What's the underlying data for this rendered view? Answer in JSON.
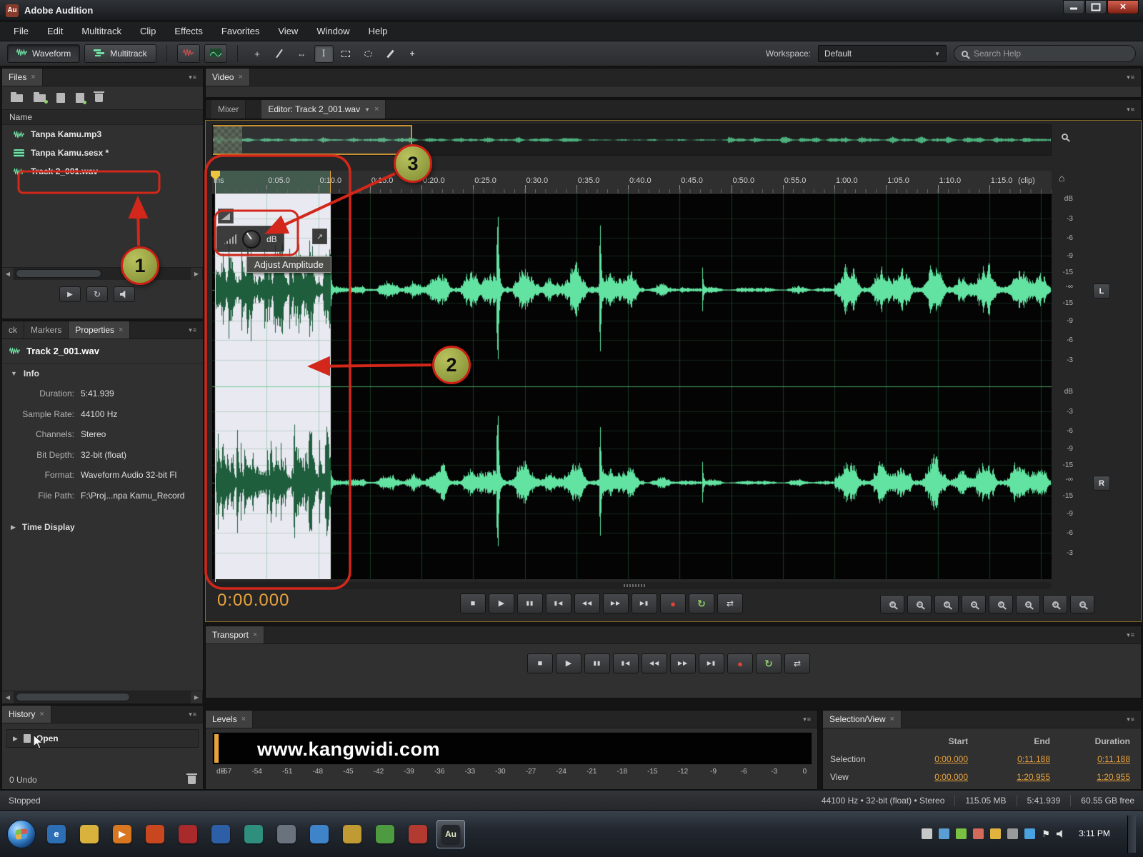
{
  "glyphs": {
    "close": "×",
    "dropdown": "▼",
    "section_open": "▼",
    "section_closed": "▶",
    "home": "⌂",
    "panel_menu": "▾≡",
    "left": "◀",
    "right": "▶",
    "expand": "↗"
  },
  "titlebar": {
    "app_initials": "Au",
    "title": "Adobe Audition"
  },
  "menubar": {
    "items": [
      "File",
      "Edit",
      "Multitrack",
      "Clip",
      "Effects",
      "Favorites",
      "View",
      "Window",
      "Help"
    ]
  },
  "toolbar": {
    "waveform_label": "Waveform",
    "multitrack_label": "Multitrack",
    "workspace_label": "Workspace:",
    "workspace_value": "Default",
    "search_placeholder": "Search Help",
    "tools": [
      "move-tool",
      "razor-tool",
      "slip-tool",
      "time-selection-tool",
      "marquee-selection-tool",
      "lasso-selection-tool",
      "paintbrush-selection-tool",
      "spot-healing-brush-tool"
    ]
  },
  "files_panel": {
    "title": "Files",
    "column_header": "Name",
    "toolbar_icons": [
      "open-file-icon",
      "import-file-icon",
      "new-item-icon",
      "insert-into-multitrack-icon",
      "delete-icon"
    ],
    "files": [
      {
        "name": "Tanpa Kamu.mp3",
        "icon": "waveform-file-icon"
      },
      {
        "name": "Tanpa Kamu.sesx *",
        "icon": "session-file-icon"
      },
      {
        "name": "Track 2_001.wav",
        "icon": "waveform-file-icon"
      }
    ],
    "preview_icons": [
      "play-preview-icon",
      "loop-preview-icon",
      "auto-play-icon"
    ]
  },
  "properties_panel": {
    "tab_partial": "ck",
    "tab_markers": "Markers",
    "tab_properties": "Properties",
    "file_name": "Track 2_001.wav",
    "section_info": "Info",
    "fields": [
      {
        "label": "Duration:",
        "value": "5:41.939"
      },
      {
        "label": "Sample Rate:",
        "value": "44100 Hz"
      },
      {
        "label": "Channels:",
        "value": "Stereo"
      },
      {
        "label": "Bit Depth:",
        "value": "32-bit (float)"
      },
      {
        "label": "Format:",
        "value": "Waveform Audio 32-bit Fl"
      },
      {
        "label": "File Path:",
        "value": "F:\\Proj...npa Kamu_Record"
      }
    ],
    "section_time_display": "Time Display"
  },
  "history_panel": {
    "title": "History",
    "entry": "Open",
    "undo_status": "0 Undo"
  },
  "editor": {
    "video_tab": "Video",
    "mixer_tab": "Mixer",
    "editor_tab": "Editor: Track 2_001.wav",
    "ruler_prefix": "ms",
    "ruler_clip": "(clip)",
    "ruler_ticks": [
      "0:05.0",
      "0:10.0",
      "0:15.0",
      "0:20.0",
      "0:25.0",
      "0:30.0",
      "0:35.0",
      "0:40.0",
      "0:45.0",
      "0:50.0",
      "0:55.0",
      "1:00.0",
      "1:05.0",
      "1:10.0",
      "1:15.0"
    ],
    "db_scale": [
      "dB",
      "-3",
      "-6",
      "-9",
      "-15",
      "-∞",
      "-15",
      "-9",
      "-6",
      "-3"
    ],
    "left_channel": "L",
    "right_channel": "R",
    "hud_tooltip": "Adjust Amplitude",
    "hud_unit": "dB",
    "time_display": "0:00.000"
  },
  "transport_buttons": [
    "stop",
    "play",
    "pause",
    "skip-to-start",
    "rewind",
    "fast-forward",
    "skip-to-end",
    "record",
    "loop-playback",
    "skip-selection"
  ],
  "zoom_buttons": [
    "zoom-in-amplitude",
    "zoom-out-amplitude",
    "zoom-in-time",
    "zoom-out-time",
    "zoom-to-selection",
    "zoom-in-horizontal",
    "zoom-out-horizontal",
    "zoom-full"
  ],
  "transport_panel": {
    "title": "Transport"
  },
  "levels_panel": {
    "title": "Levels",
    "watermark": "www.kangwidi.com",
    "scale": [
      "dB",
      "-57",
      "-54",
      "-51",
      "-48",
      "-45",
      "-42",
      "-39",
      "-36",
      "-33",
      "-30",
      "-27",
      "-24",
      "-21",
      "-18",
      "-15",
      "-12",
      "-9",
      "-6",
      "-3",
      "0"
    ]
  },
  "selection_view_panel": {
    "title": "Selection/View",
    "headers": [
      "Start",
      "End",
      "Duration"
    ],
    "rows": [
      {
        "label": "Selection",
        "start": "0:00.000",
        "end": "0:11.188",
        "duration": "0:11.188"
      },
      {
        "label": "View",
        "start": "0:00.000",
        "end": "1:20.955",
        "duration": "1:20.955"
      }
    ]
  },
  "status_bar": {
    "state": "Stopped",
    "format": "44100 Hz • 32-bit (float) • Stereo",
    "file_size": "115.05 MB",
    "duration": "5:41.939",
    "free_space": "60.55 GB free"
  },
  "taskbar": {
    "clock": "3:11 PM",
    "apps": [
      {
        "name": "taskbar-internet-explorer",
        "color": "#2d6fb5",
        "glyph": "e"
      },
      {
        "name": "taskbar-explorer",
        "color": "#d8b23c"
      },
      {
        "name": "taskbar-media-player",
        "color": "#d97620",
        "glyph": "▶"
      },
      {
        "name": "taskbar-app-orange",
        "color": "#c8471f"
      },
      {
        "name": "taskbar-app-red",
        "color": "#a82a2a"
      },
      {
        "name": "taskbar-app-blue",
        "color": "#2d5fa6"
      },
      {
        "name": "taskbar-app-teal",
        "color": "#2f8f7f"
      },
      {
        "name": "taskbar-app-gray",
        "color": "#6a737d"
      },
      {
        "name": "taskbar-app-lightblue",
        "color": "#3f84c9"
      },
      {
        "name": "taskbar-app-gold",
        "color": "#c09a32"
      },
      {
        "name": "taskbar-app-green",
        "color": "#4e9a40"
      },
      {
        "name": "taskbar-app-capture",
        "color": "#b33a30"
      },
      {
        "name": "taskbar-adobe-audition",
        "color": "#23272b",
        "glyph": "Au",
        "active": true
      }
    ]
  },
  "annotations": {
    "step1": "1",
    "step2": "2",
    "step3": "3"
  }
}
